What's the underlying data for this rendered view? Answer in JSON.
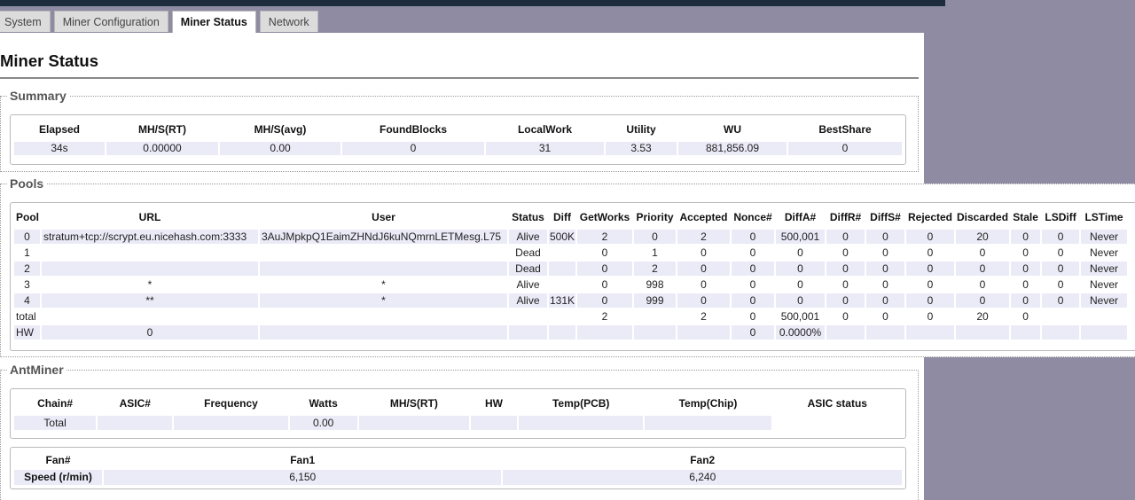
{
  "tabs": [
    "System",
    "Miner Configuration",
    "Miner Status",
    "Network"
  ],
  "active_tab": "Miner Status",
  "page_title": "Miner Status",
  "summary": {
    "legend": "Summary",
    "headers": [
      "Elapsed",
      "MH/S(RT)",
      "MH/S(avg)",
      "FoundBlocks",
      "LocalWork",
      "Utility",
      "WU",
      "BestShare"
    ],
    "values": [
      "34s",
      "0.00000",
      "0.00",
      "0",
      "31",
      "3.53",
      "881,856.09",
      "0"
    ]
  },
  "pools": {
    "legend": "Pools",
    "headers": [
      "Pool",
      "URL",
      "User",
      "Status",
      "Diff",
      "GetWorks",
      "Priority",
      "Accepted",
      "Nonce#",
      "DiffA#",
      "DiffR#",
      "DiffS#",
      "Rejected",
      "Discarded",
      "Stale",
      "LSDiff",
      "LSTime"
    ],
    "rows": [
      [
        "0",
        "stratum+tcp://scrypt.eu.nicehash.com:3333",
        "3AuJMpkpQ1EaimZHNdJ6kuNQmrnLETMesg.L75",
        "Alive",
        "500K",
        "2",
        "0",
        "2",
        "0",
        "500,001",
        "0",
        "0",
        "0",
        "20",
        "0",
        "0",
        "Never"
      ],
      [
        "1",
        "",
        "",
        "Dead",
        "",
        "0",
        "1",
        "0",
        "0",
        "0",
        "0",
        "0",
        "0",
        "0",
        "0",
        "0",
        "Never"
      ],
      [
        "2",
        "",
        "",
        "Dead",
        "",
        "0",
        "2",
        "0",
        "0",
        "0",
        "0",
        "0",
        "0",
        "0",
        "0",
        "0",
        "Never"
      ],
      [
        "3",
        "*",
        "*",
        "Alive",
        "",
        "0",
        "998",
        "0",
        "0",
        "0",
        "0",
        "0",
        "0",
        "0",
        "0",
        "0",
        "Never"
      ],
      [
        "4",
        "**",
        "*",
        "Alive",
        "131K",
        "0",
        "999",
        "0",
        "0",
        "0",
        "0",
        "0",
        "0",
        "0",
        "0",
        "0",
        "Never"
      ],
      [
        "total",
        "",
        "",
        "",
        "",
        "2",
        "",
        "2",
        "0",
        "500,001",
        "0",
        "0",
        "0",
        "20",
        "0",
        "",
        ""
      ],
      [
        "HW",
        "0",
        "",
        "",
        "",
        "",
        "",
        "",
        "0",
        "0.0000%",
        "",
        "",
        "",
        "",
        "",
        "",
        ""
      ]
    ]
  },
  "antminer": {
    "legend": "AntMiner",
    "headers": [
      "Chain#",
      "ASIC#",
      "Frequency",
      "Watts",
      "MH/S(RT)",
      "HW",
      "Temp(PCB)",
      "Temp(Chip)",
      "ASIC status"
    ],
    "total_row": [
      "Total",
      "",
      "",
      "0.00",
      "",
      "",
      "",
      "",
      ""
    ],
    "fan_headers": [
      "Fan#",
      "Fan1",
      "Fan2"
    ],
    "fan_row": [
      "Speed (r/min)",
      "6,150",
      "6,240"
    ]
  }
}
